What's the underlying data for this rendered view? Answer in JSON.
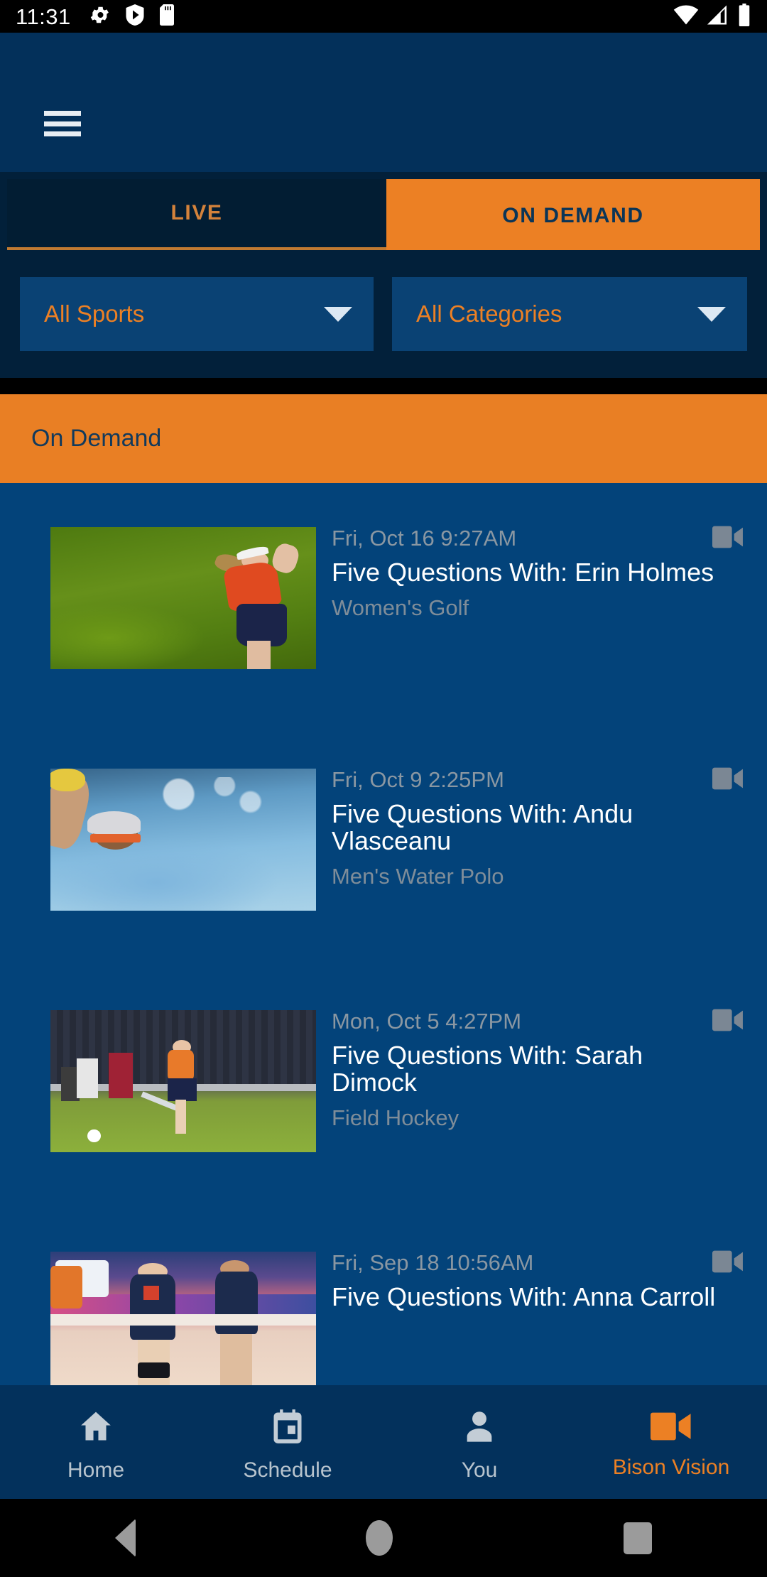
{
  "status_bar": {
    "time": "11:31",
    "left_icons": [
      "settings-gear-icon",
      "play-shield-icon",
      "sd-card-icon"
    ],
    "right_icons": [
      "wifi-icon",
      "cellular-signal-icon",
      "battery-icon"
    ]
  },
  "header": {
    "menu_icon": "hamburger-menu-icon"
  },
  "tabs": [
    {
      "label": "LIVE",
      "active": false
    },
    {
      "label": "ON DEMAND",
      "active": true
    }
  ],
  "filters": [
    {
      "label": "All Sports",
      "caret": "chevron-down-icon"
    },
    {
      "label": "All Categories",
      "caret": "chevron-down-icon"
    }
  ],
  "section": {
    "title": "On Demand"
  },
  "list": [
    {
      "date": "Fri, Oct 16 9:27AM",
      "title": "Five Questions With: Erin Holmes",
      "sport": "Women's Golf",
      "media_icon": "video-camera-icon",
      "thumb": "womens-golf-thumbnail"
    },
    {
      "date": "Fri, Oct 9 2:25PM",
      "title": "Five Questions With: Andu Vlasceanu",
      "sport": "Men's Water Polo",
      "media_icon": "video-camera-icon",
      "thumb": "mens-water-polo-thumbnail"
    },
    {
      "date": "Mon, Oct 5 4:27PM",
      "title": "Five Questions With: Sarah Dimock",
      "sport": "Field Hockey",
      "media_icon": "video-camera-icon",
      "thumb": "field-hockey-thumbnail"
    },
    {
      "date": "Fri, Sep 18 10:56AM",
      "title": "Five Questions With: Anna Carroll",
      "sport": "",
      "media_icon": "video-camera-icon",
      "thumb": "volleyball-thumbnail"
    }
  ],
  "bottom_nav": [
    {
      "label": "Home",
      "icon": "home-icon",
      "active": false
    },
    {
      "label": "Schedule",
      "icon": "calendar-icon",
      "active": false
    },
    {
      "label": "You",
      "icon": "person-icon",
      "active": false
    },
    {
      "label": "Bison Vision",
      "icon": "video-camera-icon",
      "active": true
    }
  ],
  "android_nav": {
    "back": "back-triangle-icon",
    "home": "home-circle-icon",
    "recents": "recents-square-icon"
  },
  "colors": {
    "accent_orange": "#ec8024",
    "brand_navy": "#03305a",
    "list_bg": "#03437a",
    "dark_navy": "#02203a"
  }
}
